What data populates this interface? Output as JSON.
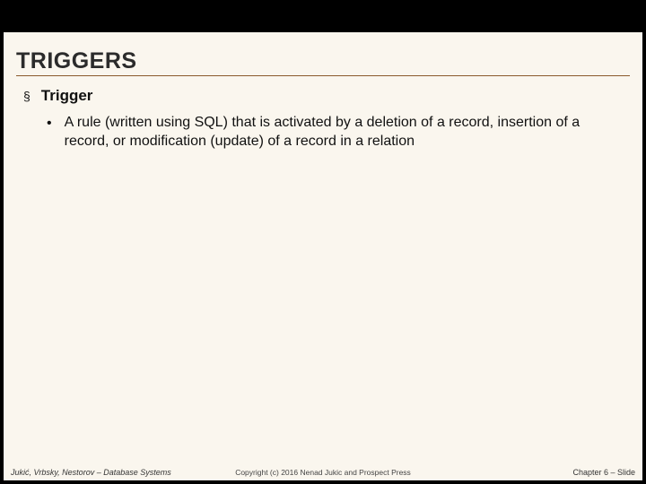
{
  "slide": {
    "title": "TRIGGERS",
    "bullet1_marker": "§",
    "bullet1_text": "Trigger",
    "bullet2_marker": "•",
    "bullet2_text": "A rule (written using SQL) that is activated by a deletion of a record, insertion of a record, or modification (update) of a record in a relation"
  },
  "footer": {
    "left": "Jukić, Vrbsky, Nestorov – Database Systems",
    "center": "Copyright (c) 2016 Nenad Jukic and Prospect Press",
    "right": "Chapter 6 – Slide"
  }
}
